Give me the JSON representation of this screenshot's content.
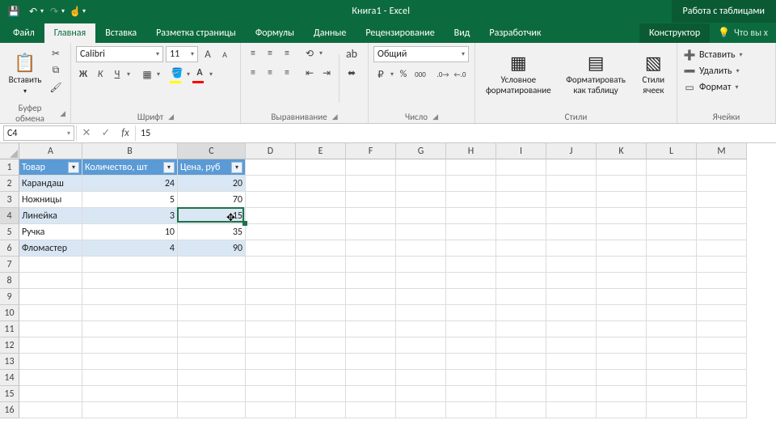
{
  "titlebar": {
    "title": "Книга1  -  Excel",
    "context_tools": "Работа с таблицами"
  },
  "qat": {
    "save": "💾",
    "undo": "↶",
    "redo": "↷",
    "touch": "☝"
  },
  "tabs": {
    "items": [
      "Файл",
      "Главная",
      "Вставка",
      "Разметка страницы",
      "Формулы",
      "Данные",
      "Рецензирование",
      "Вид",
      "Разработчик"
    ],
    "active": "Главная",
    "context": "Конструктор",
    "tellme": "Что вы х"
  },
  "ribbon": {
    "clipboard": {
      "paste": "Вставить",
      "label": "Буфер обмена"
    },
    "font": {
      "name": "Calibri",
      "size": "11",
      "label": "Шрифт",
      "increase": "A",
      "decrease": "A",
      "bold": "Ж",
      "italic": "К",
      "under": "Ч"
    },
    "align": {
      "label": "Выравнивание",
      "wrap": "⤶",
      "merge": "⇵"
    },
    "number": {
      "format": "Общий",
      "label": "Число"
    },
    "styles": {
      "cond": "Условное\nформатирование",
      "tbl": "Форматировать\nкак таблицу",
      "cell": "Стили\nячеек",
      "label": "Стили"
    },
    "cells_group": {
      "insert": "Вставить",
      "delete": "Удалить",
      "format": "Формат",
      "label": "Ячейки"
    }
  },
  "fbar": {
    "name": "C4",
    "value": "15"
  },
  "grid": {
    "cols": [
      {
        "letter": "A",
        "w": 78
      },
      {
        "letter": "B",
        "w": 118
      },
      {
        "letter": "C",
        "w": 84
      },
      {
        "letter": "D",
        "w": 62
      },
      {
        "letter": "E",
        "w": 62
      },
      {
        "letter": "F",
        "w": 62
      },
      {
        "letter": "G",
        "w": 62
      },
      {
        "letter": "H",
        "w": 62
      },
      {
        "letter": "I",
        "w": 62
      },
      {
        "letter": "J",
        "w": 62
      },
      {
        "letter": "K",
        "w": 62
      },
      {
        "letter": "L",
        "w": 62
      },
      {
        "letter": "M",
        "w": 62
      }
    ],
    "rows": 16,
    "headers": [
      "Товар",
      "Количество, шт",
      "Цена, руб"
    ],
    "data": [
      {
        "a": "Карандаш",
        "b": "24",
        "c": "20"
      },
      {
        "a": "Ножницы",
        "b": "5",
        "c": "70"
      },
      {
        "a": "Линейка",
        "b": "3",
        "c": "15"
      },
      {
        "a": "Ручка",
        "b": "10",
        "c": "35"
      },
      {
        "a": "Фломастер",
        "b": "4",
        "c": "90"
      }
    ],
    "active": {
      "r": 4,
      "c": 3
    }
  }
}
